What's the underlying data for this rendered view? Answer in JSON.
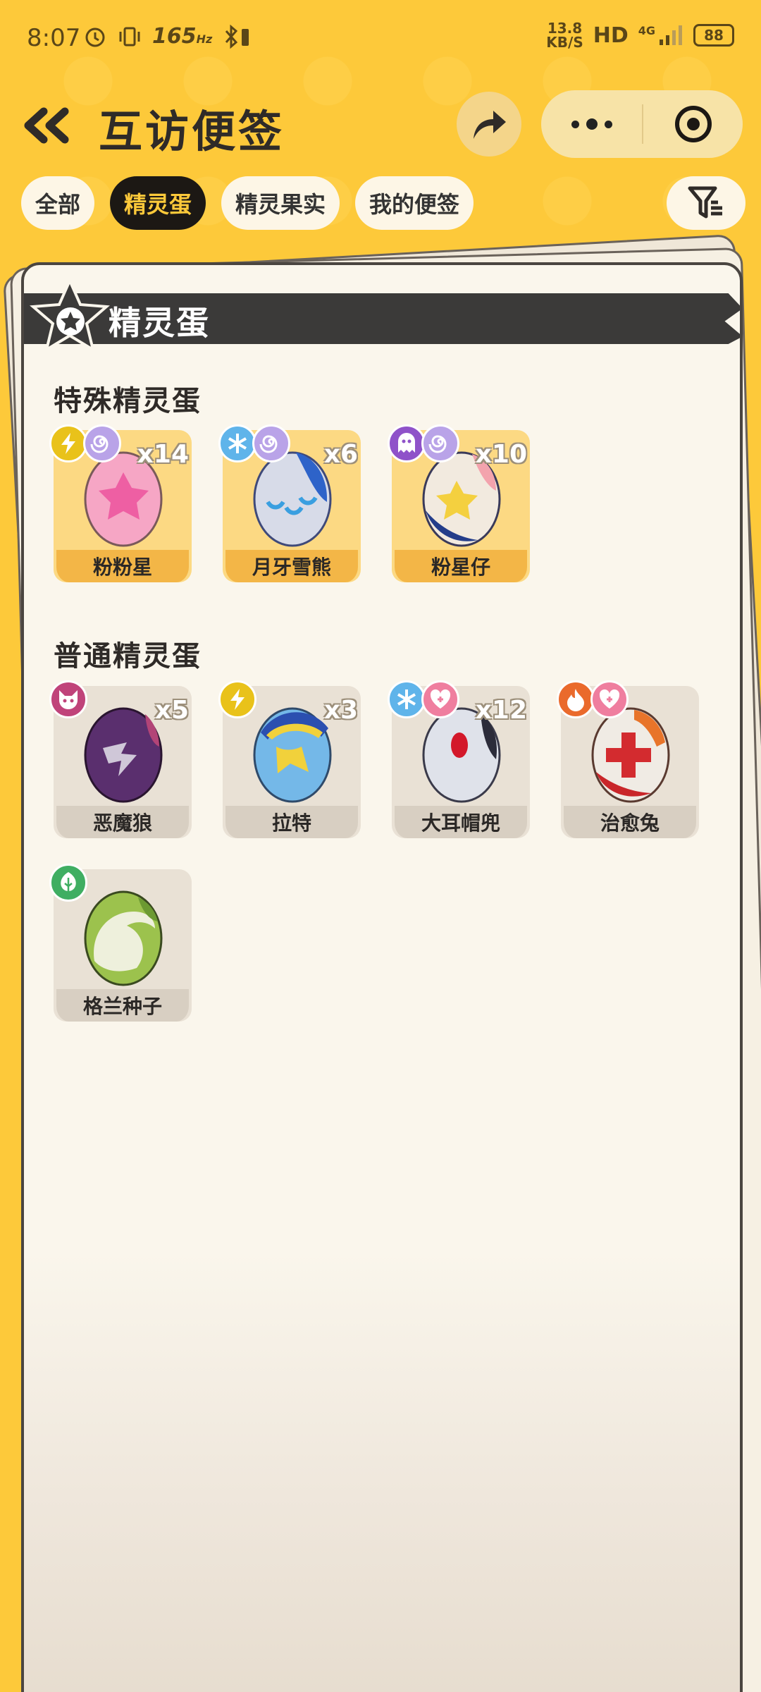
{
  "status_bar": {
    "time": "8:07",
    "refresh_rate": "165",
    "refresh_unit": "Hz",
    "net_speed_value": "13.8",
    "net_speed_unit": "KB/S",
    "hd_label": "HD",
    "network": "4G",
    "battery": "88"
  },
  "header": {
    "title": "互访便签",
    "back_icon": "double-chevron-left-icon",
    "share_icon": "share-arrow-icon",
    "more_icon": "more-dots-icon",
    "close_icon": "target-circle-icon"
  },
  "tabs": [
    {
      "label": "全部",
      "active": false
    },
    {
      "label": "精灵蛋",
      "active": true
    },
    {
      "label": "精灵果实",
      "active": false
    },
    {
      "label": "我的便签",
      "active": false
    }
  ],
  "filter_icon": "filter-funnel-icon",
  "panel": {
    "banner_title": "精灵蛋",
    "special_section": {
      "title": "特殊精灵蛋",
      "items": [
        {
          "name": "粉粉星",
          "count": "x14",
          "badges": [
            "electric",
            "psychic"
          ]
        },
        {
          "name": "月牙雪熊",
          "count": "x6",
          "badges": [
            "ice",
            "psychic"
          ]
        },
        {
          "name": "粉星仔",
          "count": "x10",
          "badges": [
            "ghost",
            "psychic"
          ]
        }
      ]
    },
    "normal_section": {
      "title": "普通精灵蛋",
      "items": [
        {
          "name": "恶魔狼",
          "count": "x5",
          "badges": [
            "demon"
          ]
        },
        {
          "name": "拉特",
          "count": "x3",
          "badges": [
            "electric"
          ]
        },
        {
          "name": "大耳帽兜",
          "count": "x12",
          "badges": [
            "ice",
            "cute"
          ]
        },
        {
          "name": "治愈兔",
          "count": "",
          "badges": [
            "fire",
            "cute"
          ]
        },
        {
          "name": "格兰种子",
          "count": "",
          "badges": [
            "grass"
          ]
        }
      ]
    }
  },
  "colors": {
    "background": "#fdc93a",
    "active_tab_bg": "#1c1814",
    "active_tab_text": "#fdc93a",
    "special_card": "#fcd983",
    "normal_card": "#e9e1d5",
    "electric": "#e9c21a",
    "psychic": "#b9a3e8",
    "ice": "#5fb4ea",
    "ghost": "#8f52c9",
    "demon": "#c0437a",
    "cute": "#ef7e9f",
    "fire": "#ea6a2c",
    "grass": "#3fae62"
  }
}
